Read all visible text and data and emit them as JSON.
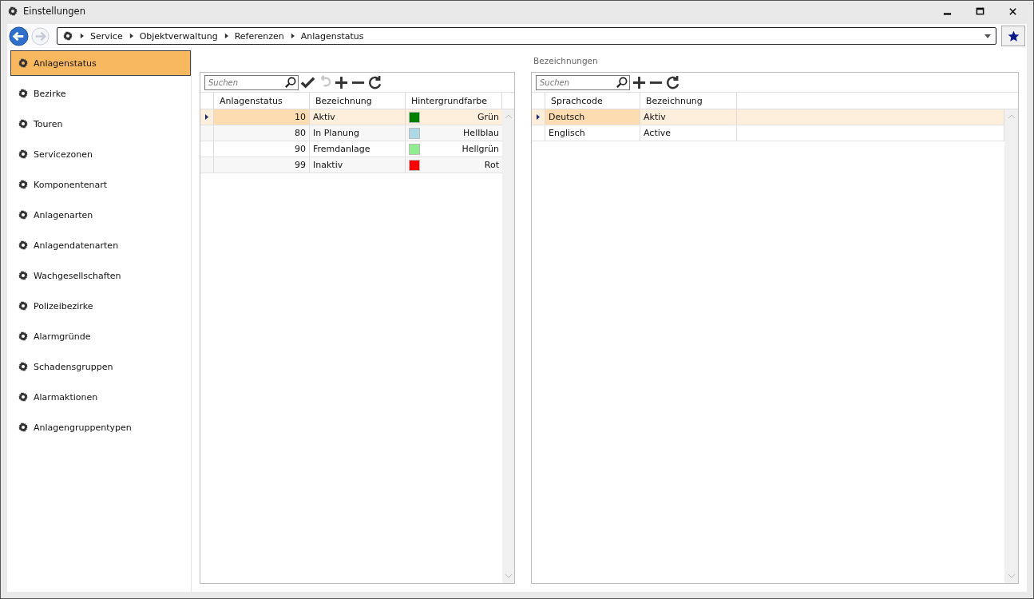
{
  "window": {
    "title": "Einstellungen"
  },
  "breadcrumb": [
    "Service",
    "Objektverwaltung",
    "Referenzen",
    "Anlagenstatus"
  ],
  "sidebar": {
    "items": [
      {
        "label": "Anlagenstatus",
        "selected": true
      },
      {
        "label": "Bezirke",
        "selected": false
      },
      {
        "label": "Touren",
        "selected": false
      },
      {
        "label": "Servicezonen",
        "selected": false
      },
      {
        "label": "Komponentenart",
        "selected": false
      },
      {
        "label": "Anlagenarten",
        "selected": false
      },
      {
        "label": "Anlagendatenarten",
        "selected": false
      },
      {
        "label": "Wachgesellschaften",
        "selected": false
      },
      {
        "label": "Polizeibezirke",
        "selected": false
      },
      {
        "label": "Alarmgründe",
        "selected": false
      },
      {
        "label": "Schadensgruppen",
        "selected": false
      },
      {
        "label": "Alarmaktionen",
        "selected": false
      },
      {
        "label": "Anlagengruppentypen",
        "selected": false
      }
    ]
  },
  "status_panel": {
    "search": {
      "placeholder": "Suchen"
    },
    "toolbar": [
      {
        "kind": "save",
        "disabled": false
      },
      {
        "kind": "undo",
        "disabled": true
      },
      {
        "kind": "add",
        "disabled": false
      },
      {
        "kind": "remove",
        "disabled": false
      },
      {
        "kind": "refresh",
        "disabled": false
      }
    ],
    "columns": [
      "Anlagenstatus",
      "Bezeichnung",
      "Hintergrundfarbe"
    ],
    "rows": [
      {
        "code": "10",
        "name": "Aktiv",
        "color": "#008000",
        "color_name": "Grün",
        "selected": true
      },
      {
        "code": "80",
        "name": "In Planung",
        "color": "#add8e6",
        "color_name": "Hellblau",
        "selected": false
      },
      {
        "code": "90",
        "name": "Fremdanlage",
        "color": "#90ee90",
        "color_name": "Hellgrün",
        "selected": false
      },
      {
        "code": "99",
        "name": "Inaktiv",
        "color": "#ff0000",
        "color_name": "Rot",
        "selected": false
      }
    ]
  },
  "names_panel": {
    "title": "Bezeichnungen",
    "search": {
      "placeholder": "Suchen"
    },
    "toolbar": [
      {
        "kind": "add",
        "disabled": false
      },
      {
        "kind": "remove",
        "disabled": false
      },
      {
        "kind": "refresh",
        "disabled": false
      }
    ],
    "columns": [
      "Sprachcode",
      "Bezeichnung"
    ],
    "rows": [
      {
        "language": "Deutsch",
        "name": "Aktiv",
        "selected": true
      },
      {
        "language": "Englisch",
        "name": "Active",
        "selected": false
      }
    ]
  }
}
